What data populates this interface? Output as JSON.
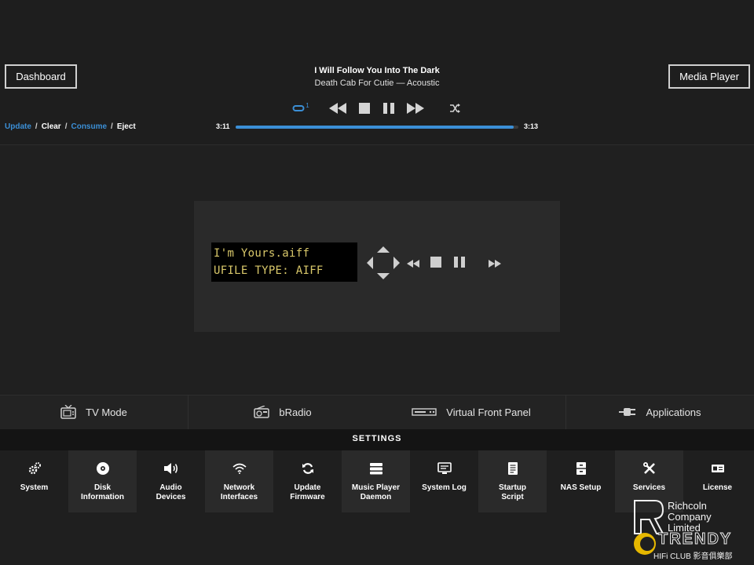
{
  "header": {
    "dashboard_label": "Dashboard",
    "media_player_label": "Media Player",
    "now_playing": {
      "title": "I Will Follow You Into The Dark",
      "subtitle": "Death Cab For Cutie — Acoustic"
    },
    "repeat_badge": "1",
    "queue_links": [
      "Update",
      "Clear",
      "Consume",
      "Eject"
    ],
    "time_elapsed": "3:11",
    "time_total": "3:13",
    "progress_fraction": 0.984,
    "accent_color": "#3b8fd6"
  },
  "front_panel": {
    "lcd_line1": "I'm Yours.aiff",
    "lcd_line2": "UFILE TYPE: AIFF",
    "lcd_color": "#d9c86a"
  },
  "modes": [
    {
      "label": "TV Mode",
      "icon": "tv-icon"
    },
    {
      "label": "bRadio",
      "icon": "radio-icon"
    },
    {
      "label": "Virtual Front Panel",
      "icon": "front-panel-icon"
    },
    {
      "label": "Applications",
      "icon": "plug-icon"
    }
  ],
  "settings": {
    "title": "SETTINGS",
    "tiles": [
      {
        "label": "System",
        "icon": "gears-icon"
      },
      {
        "label": "Disk\nInformation",
        "icon": "disc-icon"
      },
      {
        "label": "Audio\nDevices",
        "icon": "speaker-icon"
      },
      {
        "label": "Network\nInterfaces",
        "icon": "wifi-icon"
      },
      {
        "label": "Update\nFirmware",
        "icon": "refresh-icon"
      },
      {
        "label": "Music Player\nDaemon",
        "icon": "stack-icon"
      },
      {
        "label": "System Log",
        "icon": "monitor-icon"
      },
      {
        "label": "Startup\nScript",
        "icon": "script-icon"
      },
      {
        "label": "NAS Setup",
        "icon": "cabinet-icon"
      },
      {
        "label": "Services",
        "icon": "tools-icon"
      },
      {
        "label": "License",
        "icon": "id-card-icon"
      }
    ]
  },
  "watermark": {
    "lines": [
      "Richcoln",
      "Company",
      "Limited"
    ],
    "brand": "TRENDY",
    "club": "HIFi CLUB 影音俱樂部"
  }
}
